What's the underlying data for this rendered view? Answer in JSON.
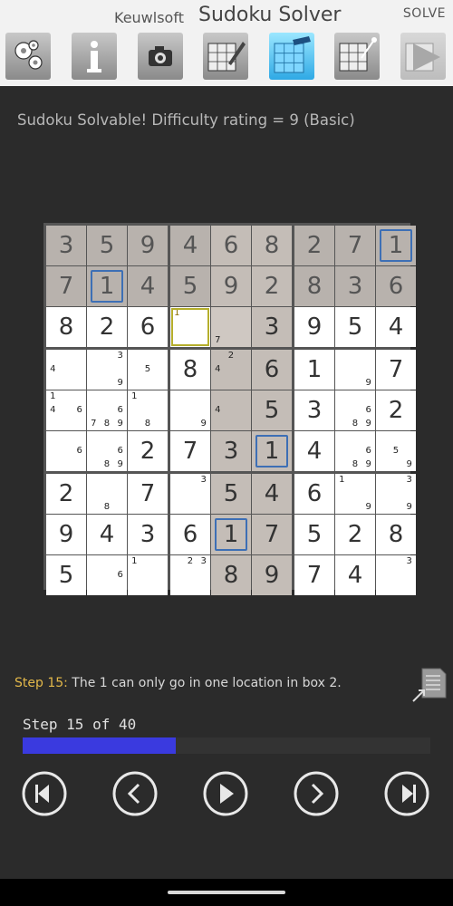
{
  "app": {
    "publisher": "Keuwlsoft",
    "title": "Sudoku Solver",
    "mode": "SOLVE"
  },
  "toolbar": [
    {
      "name": "settings-button",
      "icon": "gears-icon"
    },
    {
      "name": "info-button",
      "icon": "info-icon"
    },
    {
      "name": "camera-button",
      "icon": "camera-icon"
    },
    {
      "name": "edit-grid-button",
      "icon": "pencil-grid-icon"
    },
    {
      "name": "solve-grid-button",
      "icon": "solve-grid-icon",
      "active": true
    },
    {
      "name": "clear-grid-button",
      "icon": "wand-grid-icon"
    },
    {
      "name": "play-button",
      "icon": "play-icon",
      "disabled": true
    }
  ],
  "status": "Sudoku Solvable!  Difficulty rating = 9 (Basic)",
  "board": {
    "rows": [
      [
        {
          "v": "3",
          "given": true
        },
        {
          "v": "5",
          "given": true
        },
        {
          "v": "9",
          "given": true
        },
        {
          "v": "4",
          "given": true
        },
        {
          "v": "6",
          "given": true
        },
        {
          "v": "8",
          "given": true
        },
        {
          "v": "2",
          "given": true
        },
        {
          "v": "7",
          "given": true
        },
        {
          "v": "1",
          "given": true,
          "frame": true
        }
      ],
      [
        {
          "v": "7",
          "given": true
        },
        {
          "v": "1",
          "given": true,
          "frame": true
        },
        {
          "v": "4",
          "given": true
        },
        {
          "v": "5",
          "given": true
        },
        {
          "v": "9",
          "given": true
        },
        {
          "v": "2",
          "given": true
        },
        {
          "v": "8",
          "given": true
        },
        {
          "v": "3",
          "given": true
        },
        {
          "v": "6",
          "given": true
        }
      ],
      [
        {
          "v": "8"
        },
        {
          "v": "2"
        },
        {
          "v": "6"
        },
        {
          "v": "",
          "c": [
            1
          ],
          "hl": [
            1
          ],
          "yframe": true
        },
        {
          "v": "",
          "c": [
            7
          ]
        },
        {
          "v": "3"
        },
        {
          "v": "9"
        },
        {
          "v": "5"
        },
        {
          "v": "4"
        }
      ],
      [
        {
          "v": "",
          "c": [
            4
          ]
        },
        {
          "v": "",
          "c": [
            3,
            9
          ]
        },
        {
          "v": "",
          "c": [
            5
          ]
        },
        {
          "v": "8"
        },
        {
          "v": "",
          "c": [
            2,
            4
          ]
        },
        {
          "v": "6"
        },
        {
          "v": "1"
        },
        {
          "v": "",
          "c": [
            9
          ]
        },
        {
          "v": "7"
        }
      ],
      [
        {
          "v": "",
          "c": [
            1,
            4,
            6
          ]
        },
        {
          "v": "",
          "c": [
            6,
            7,
            8,
            9
          ]
        },
        {
          "v": "",
          "c": [
            1,
            8
          ]
        },
        {
          "v": "",
          "c": [
            9
          ]
        },
        {
          "v": "",
          "c": [
            4
          ]
        },
        {
          "v": "5"
        },
        {
          "v": "3"
        },
        {
          "v": "",
          "c": [
            6,
            8,
            9
          ]
        },
        {
          "v": "2"
        }
      ],
      [
        {
          "v": "",
          "c": [
            6
          ]
        },
        {
          "v": "",
          "c": [
            6,
            8,
            9
          ]
        },
        {
          "v": "2"
        },
        {
          "v": "7"
        },
        {
          "v": "3"
        },
        {
          "v": "1",
          "frame": true
        },
        {
          "v": "4"
        },
        {
          "v": "",
          "c": [
            6,
            8,
            9
          ]
        },
        {
          "v": "",
          "c": [
            5,
            9
          ]
        }
      ],
      [
        {
          "v": "2"
        },
        {
          "v": "",
          "c": [
            8
          ]
        },
        {
          "v": "7"
        },
        {
          "v": "",
          "c": [
            3
          ]
        },
        {
          "v": "5"
        },
        {
          "v": "4"
        },
        {
          "v": "6"
        },
        {
          "v": "",
          "c": [
            1,
            9
          ]
        },
        {
          "v": "",
          "c": [
            3,
            9
          ]
        }
      ],
      [
        {
          "v": "9"
        },
        {
          "v": "4"
        },
        {
          "v": "3"
        },
        {
          "v": "6"
        },
        {
          "v": "1",
          "frame": true
        },
        {
          "v": "7"
        },
        {
          "v": "5"
        },
        {
          "v": "2"
        },
        {
          "v": "8"
        }
      ],
      [
        {
          "v": "5"
        },
        {
          "v": "",
          "c": [
            6
          ]
        },
        {
          "v": "",
          "c": [
            1
          ]
        },
        {
          "v": "",
          "c": [
            2,
            3
          ]
        },
        {
          "v": "8"
        },
        {
          "v": "9"
        },
        {
          "v": "7"
        },
        {
          "v": "4"
        },
        {
          "v": "",
          "c": [
            3
          ]
        }
      ]
    ],
    "shade": {
      "given_rows": "#b8b2ad",
      "box2_column": "#c4bdb7",
      "box2_empty": "#cfc8c2"
    }
  },
  "step": {
    "label": "Step 15:",
    "text": " The 1 can only go in one location in box 2."
  },
  "progress": {
    "text": "Step 15 of 40",
    "current": 15,
    "total": 40
  },
  "controls": [
    {
      "name": "first-step-button",
      "icon": "skip-start-icon"
    },
    {
      "name": "prev-step-button",
      "icon": "chevron-left-icon"
    },
    {
      "name": "play-steps-button",
      "icon": "play-icon"
    },
    {
      "name": "next-step-button",
      "icon": "chevron-right-icon"
    },
    {
      "name": "last-step-button",
      "icon": "skip-end-icon"
    }
  ]
}
